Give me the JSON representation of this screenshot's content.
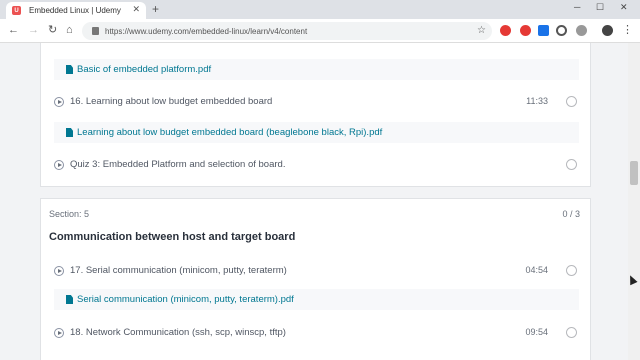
{
  "browser": {
    "tab_title": "Embedded Linux | Udemy",
    "url": "https://www.udemy.com/embedded-linux/learn/v4/content",
    "favicon_letter": "U",
    "close_glyph": "✕",
    "new_tab_glyph": "+"
  },
  "section4": {
    "items": [
      {
        "type": "resource",
        "label": "Basic of embedded platform.pdf"
      },
      {
        "type": "lecture",
        "label": "16. Learning about low budget embedded board",
        "duration": "11:33"
      },
      {
        "type": "resource",
        "label": "Learning about low budget embedded board (beaglebone black, Rpi).pdf"
      },
      {
        "type": "quiz",
        "label": "Quiz 3: Embedded Platform and selection of board."
      }
    ]
  },
  "section5": {
    "number": "Section: 5",
    "progress": "0 / 3",
    "title": "Communication between host and target board",
    "items": [
      {
        "type": "lecture",
        "label": "17. Serial communication (minicom, putty, teraterm)",
        "duration": "04:54"
      },
      {
        "type": "resource",
        "label": "Serial communication (minicom, putty, teraterm).pdf"
      },
      {
        "type": "lecture",
        "label": "18. Network Communication (ssh, scp, winscp, tftp)",
        "duration": "09:54"
      }
    ]
  },
  "colors": {
    "link": "#007791",
    "accent": "#ec5252"
  },
  "icons": [
    "back-arrow-icon",
    "forward-arrow-icon",
    "reload-icon",
    "lock-icon",
    "bookmark-star-icon",
    "play-icon",
    "pdf-file-icon",
    "checkbox-circle-icon"
  ]
}
